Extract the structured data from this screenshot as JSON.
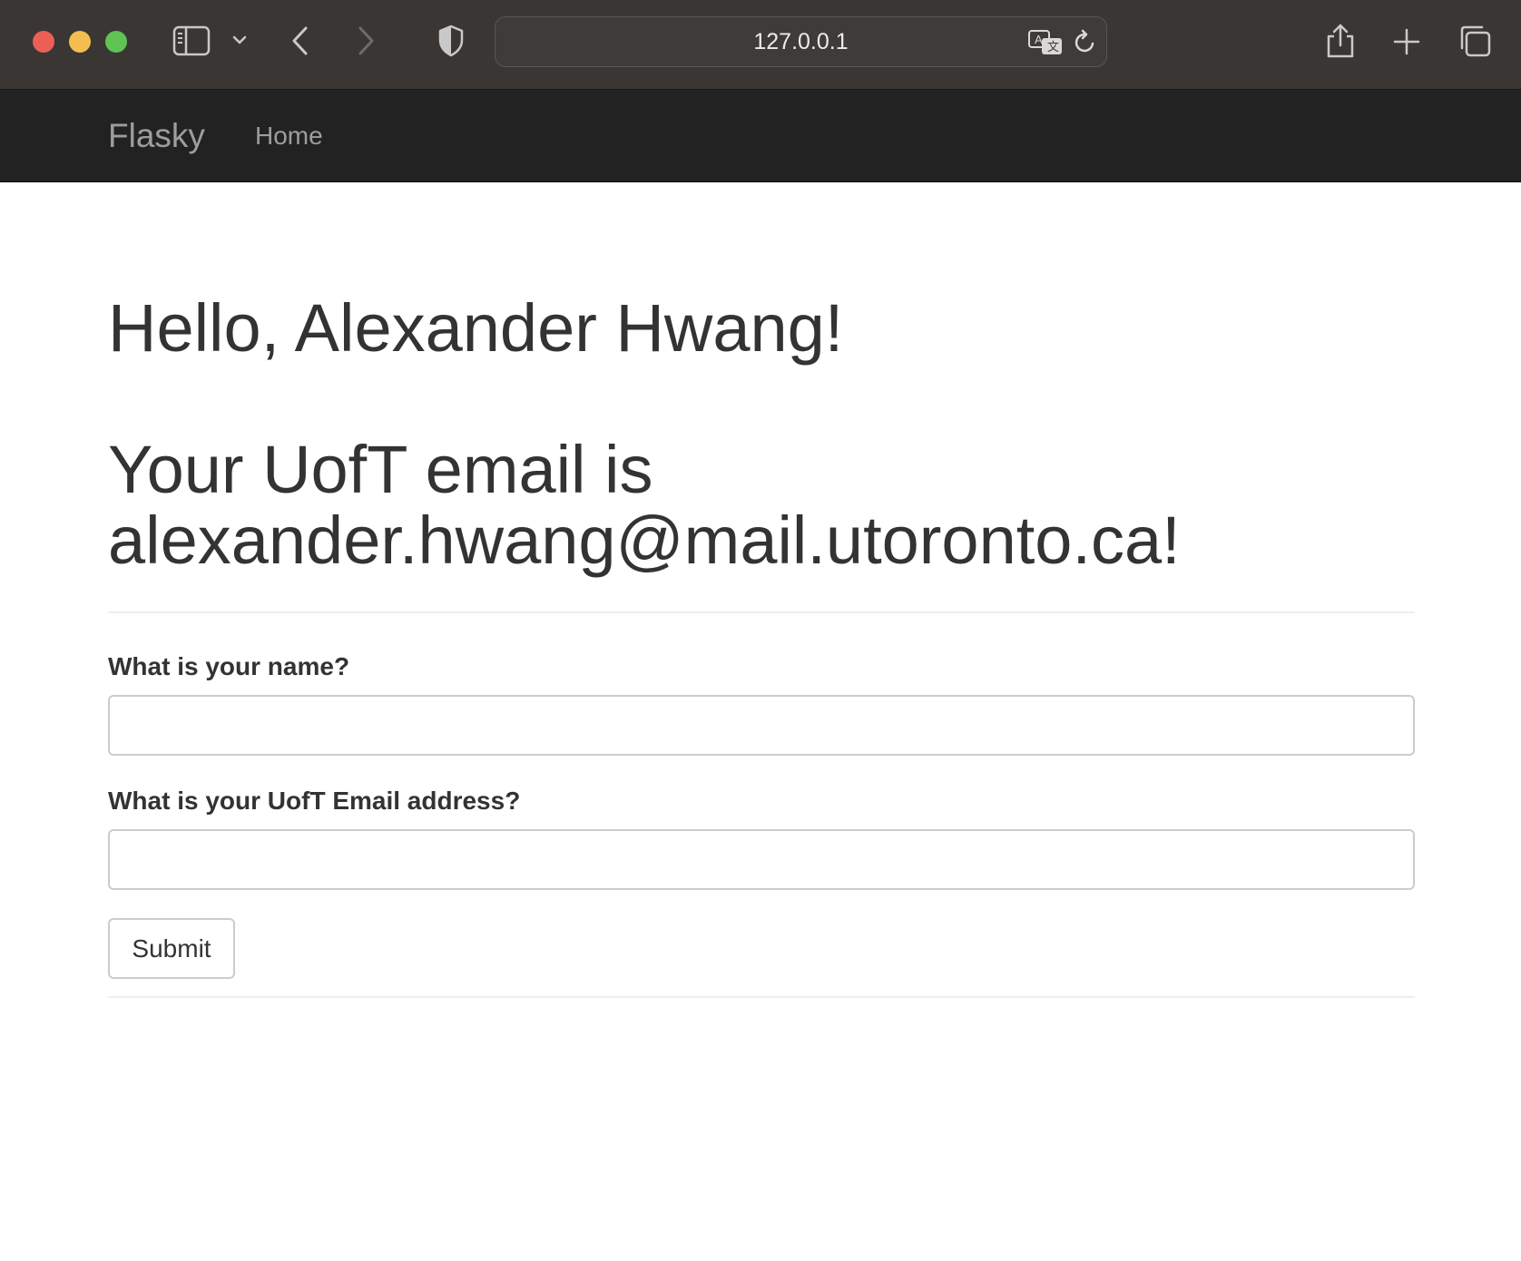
{
  "browser": {
    "address": "127.0.0.1",
    "icons": [
      "sidebar-icon",
      "chevron-down-icon",
      "back-arrow-icon",
      "forward-arrow-icon",
      "shield-icon",
      "translate-icon",
      "reload-icon",
      "share-icon",
      "new-tab-plus-icon",
      "tabs-overview-icon"
    ],
    "traffic_light_colors": {
      "close": "#ec5f57",
      "minimize": "#f3bd4f",
      "zoom": "#5fc454"
    }
  },
  "navbar": {
    "brand": "Flasky",
    "links": [
      {
        "label": "Home"
      }
    ],
    "background": "#222222",
    "link_color": "#9d9d9d"
  },
  "page": {
    "greeting": "Hello, Alexander Hwang!",
    "email_message": "Your UofT email is alexander.hwang@mail.utoronto.ca!"
  },
  "form": {
    "name_label": "What is your name?",
    "name_value": "",
    "email_label": "What is your UofT Email address?",
    "email_value": "",
    "submit_label": "Submit"
  }
}
